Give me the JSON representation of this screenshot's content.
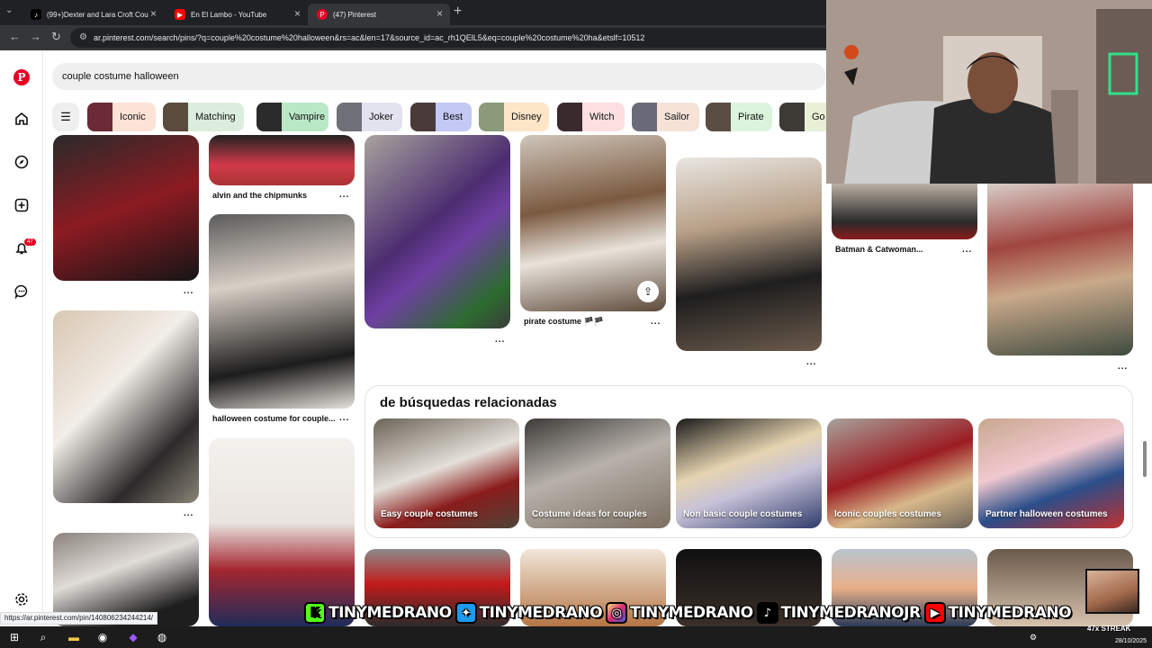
{
  "browser": {
    "tabs": [
      {
        "label": "(99+)Dexter and Lara Croft Cou",
        "favicon": "tiktok-icon",
        "color": "#000000"
      },
      {
        "label": "En El Lambo - YouTube",
        "favicon": "youtube-icon",
        "color": "#ff0000"
      },
      {
        "label": "(47) Pinterest",
        "favicon": "pinterest-icon",
        "color": "#e60023"
      }
    ],
    "url": "ar.pinterest.com/search/pins/?q=couple%20costume%20halloween&rs=ac&len=17&source_id=ac_rh1QElL5&eq=couple%20costume%20ha&etslf=10512"
  },
  "search": {
    "value": "couple costume halloween"
  },
  "notifications": {
    "count": "47"
  },
  "chips": [
    {
      "label": "Iconic",
      "color": "#fde2d6"
    },
    {
      "label": "Matching",
      "color": "#dbeedd"
    },
    {
      "label": "Vampire",
      "color": "#b9e8c6"
    },
    {
      "label": "Joker",
      "color": "#e3e3ef"
    },
    {
      "label": "Best",
      "color": "#c3c8f5"
    },
    {
      "label": "Disney",
      "color": "#fde5c8"
    },
    {
      "label": "Witch",
      "color": "#fddfe2"
    },
    {
      "label": "Sailor",
      "color": "#f5e3d7"
    },
    {
      "label": "Pirate",
      "color": "#dcf3dc"
    },
    {
      "label": "Go",
      "color": "#e8f0d6"
    }
  ],
  "pins": {
    "alvin": "alvin and the chipmunks",
    "halloween": "halloween costume for couple...",
    "pirate": "pirate costume 🏴🏴",
    "batman": "Batman & Catwoman...",
    "more": "..."
  },
  "related": {
    "title": "de búsquedas relacionadas",
    "items": [
      {
        "label": "Easy couple costumes",
        "color": "#7a6a55"
      },
      {
        "label": "Costume ideas for couples",
        "color": "#8a8680"
      },
      {
        "label": "Non basic couple costumes",
        "color": "#3a3a46"
      },
      {
        "label": "Iconic couples costumes",
        "color": "#9a5a4a"
      },
      {
        "label": "Partner halloween costumes",
        "color": "#b2806a"
      }
    ]
  },
  "status_url": "https://ar.pinterest.com/pin/140806234244214/",
  "social": {
    "kick": "TINYMEDRANO",
    "twitter": "TINYMEDRANO",
    "instagram": "TINYMEDRANO",
    "tiktok": "TINYMEDRANOJR",
    "youtube": "TINYMEDRANO"
  },
  "streak": "47x STREAK",
  "clock": {
    "date": "28/10/2025"
  }
}
